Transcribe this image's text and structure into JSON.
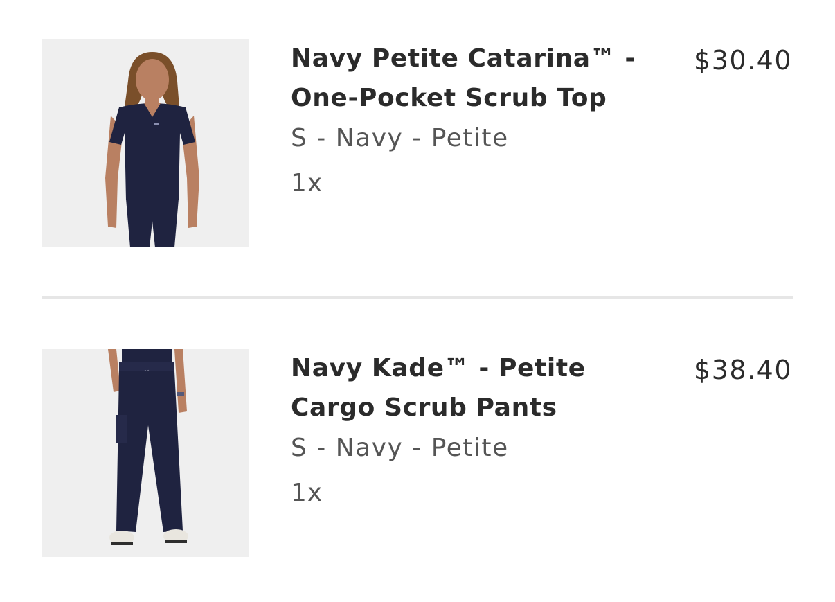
{
  "cart": {
    "items": [
      {
        "title": "Navy Petite Catarina™ - One-Pocket Scrub Top",
        "variant": "S - Navy - Petite",
        "quantity": "1x",
        "price": "$30.40",
        "image_icon": "scrub-top-photo"
      },
      {
        "title": "Navy Kade™ - Petite Cargo Scrub Pants",
        "variant": "S - Navy - Petite",
        "quantity": "1x",
        "price": "$38.40",
        "image_icon": "scrub-pants-photo"
      }
    ]
  },
  "colors": {
    "navy": "#1f2340",
    "photo_bg": "#efefef",
    "text": "#2b2b2b",
    "muted": "#555555",
    "divider": "#e6e6e6"
  }
}
